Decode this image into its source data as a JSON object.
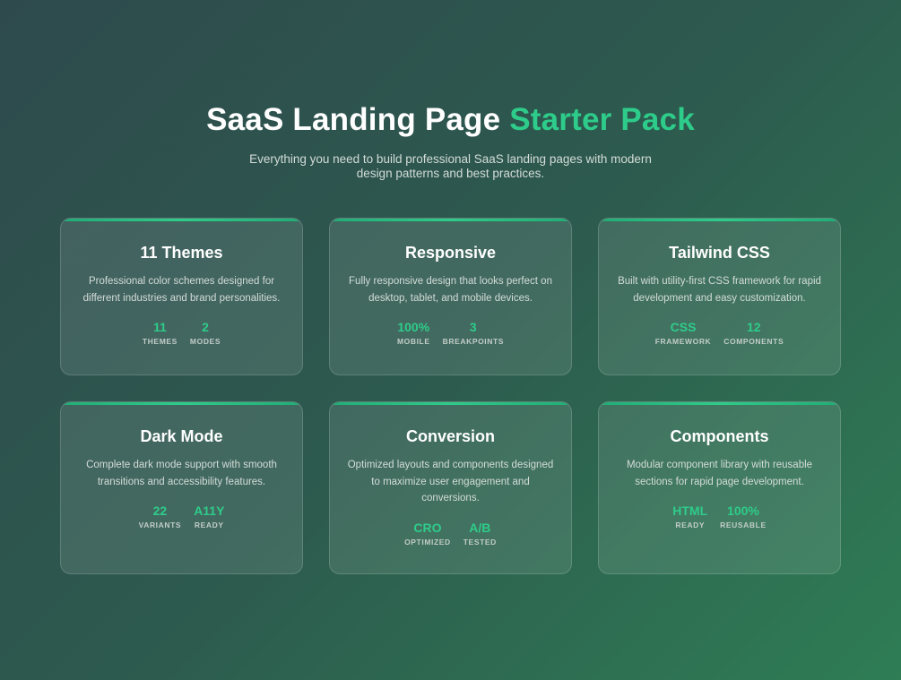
{
  "hero": {
    "title_main": "SaaS Landing Page",
    "title_accent": "Starter Pack",
    "subtitle": "Everything you need to build professional SaaS landing pages with modern design patterns and best practices."
  },
  "colors": {
    "accent": "#2ecc8a",
    "background_start": "#2e4a4d",
    "background_end": "#2e7d55"
  },
  "cards": [
    {
      "title": "11 Themes",
      "description": "Professional color schemes designed for different industries and brand personalities.",
      "stats": [
        {
          "value": "11",
          "label": "THEMES"
        },
        {
          "value": "2",
          "label": "MODES"
        }
      ]
    },
    {
      "title": "Responsive",
      "description": "Fully responsive design that looks perfect on desktop, tablet, and mobile devices.",
      "stats": [
        {
          "value": "100%",
          "label": "MOBILE"
        },
        {
          "value": "3",
          "label": "BREAKPOINTS"
        }
      ]
    },
    {
      "title": "Tailwind CSS",
      "description": "Built with utility-first CSS framework for rapid development and easy customization.",
      "stats": [
        {
          "value": "CSS",
          "label": "FRAMEWORK"
        },
        {
          "value": "12",
          "label": "COMPONENTS"
        }
      ]
    },
    {
      "title": "Dark Mode",
      "description": "Complete dark mode support with smooth transitions and accessibility features.",
      "stats": [
        {
          "value": "22",
          "label": "VARIANTS"
        },
        {
          "value": "A11Y",
          "label": "READY"
        }
      ]
    },
    {
      "title": "Conversion",
      "description": "Optimized layouts and components designed to maximize user engagement and conversions.",
      "stats": [
        {
          "value": "CRO",
          "label": "OPTIMIZED"
        },
        {
          "value": "A/B",
          "label": "TESTED"
        }
      ]
    },
    {
      "title": "Components",
      "description": "Modular component library with reusable sections for rapid page development.",
      "stats": [
        {
          "value": "HTML",
          "label": "READY"
        },
        {
          "value": "100%",
          "label": "REUSABLE"
        }
      ]
    }
  ]
}
